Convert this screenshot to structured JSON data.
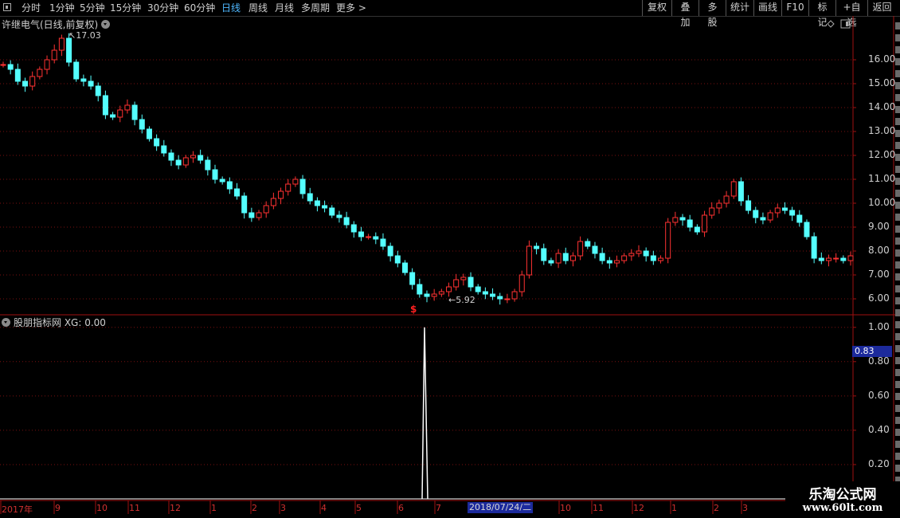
{
  "toolbar": {
    "periods": [
      "分时",
      "1分钟",
      "5分钟",
      "15分钟",
      "30分钟",
      "60分钟",
      "日线",
      "周线",
      "月线",
      "多周期",
      "更多 >"
    ],
    "active_period": "日线",
    "right_buttons": [
      "复权",
      "叠加",
      "多股",
      "统计",
      "画线",
      "F10",
      "标记",
      "+自选",
      "返回"
    ]
  },
  "main_chart": {
    "title": "许继电气(日线,前复权)",
    "high_marker": "17.03",
    "low_marker": "5.92",
    "signal_marker": "$",
    "price_axis": [
      "16.00",
      "15.00",
      "14.00",
      "13.00",
      "12.00",
      "11.00",
      "10.00",
      "9.00",
      "8.00",
      "7.00",
      "6.00"
    ]
  },
  "indicator": {
    "title": "股朋指标网 XG: 0.00",
    "axis": [
      "1.00",
      "0.80",
      "0.60",
      "0.40",
      "0.20"
    ],
    "cursor_value": "0.83"
  },
  "date_axis": {
    "ticks": [
      "2017年",
      "9",
      "10",
      "11",
      "12",
      "1",
      "2",
      "3",
      "4",
      "5",
      "6",
      "7",
      "10",
      "11",
      "12",
      "1",
      "2",
      "3"
    ],
    "cursor_date": "2018/07/24/二"
  },
  "watermark": {
    "line1": "乐淘公式网",
    "line2": "www.60lt.com"
  },
  "chart_data": {
    "type": "candlestick",
    "series": [
      {
        "values": [
          15.8,
          15.6,
          15.1,
          14.9,
          15.3,
          15.6,
          16.0,
          16.4,
          16.9,
          15.9,
          15.2,
          15.1,
          14.9,
          14.5,
          13.7,
          13.6,
          13.9,
          14.1,
          13.5,
          13.1,
          12.7,
          12.4,
          12.1,
          11.8,
          11.6,
          11.9,
          12.0,
          11.8,
          11.4,
          11.0,
          10.9,
          10.6,
          10.3,
          9.6,
          9.4,
          9.6,
          9.9,
          10.2,
          10.5,
          10.8,
          11.0,
          10.4,
          10.1,
          9.9,
          9.8,
          9.5,
          9.4,
          9.1,
          8.8,
          8.6,
          8.6,
          8.5,
          8.2,
          7.8,
          7.5,
          7.1,
          6.6,
          6.2,
          6.1,
          6.2,
          6.3,
          6.5,
          6.8,
          6.9,
          6.5,
          6.3,
          6.2,
          6.1,
          6.0,
          6.0,
          6.3,
          7.0,
          8.2,
          8.1,
          7.6,
          7.5,
          7.9,
          7.6,
          7.8,
          8.4,
          8.2,
          7.9,
          7.6,
          7.5,
          7.6,
          7.8,
          7.9,
          8.0,
          7.8,
          7.6,
          7.7,
          9.2,
          9.4,
          9.3,
          9.0,
          8.8,
          9.5,
          9.8,
          10.0,
          10.3,
          10.9,
          10.1,
          9.7,
          9.4,
          9.3,
          9.6,
          9.8,
          9.7,
          9.5,
          9.2,
          8.6,
          7.7,
          7.6,
          7.7,
          7.7,
          7.6,
          7.8
        ]
      }
    ],
    "y_ticks": [
      "16.00",
      "15.00",
      "14.00",
      "13.00",
      "12.00",
      "11.00",
      "10.00",
      "9.00",
      "8.00",
      "7.00",
      "6.00"
    ],
    "ylim": [
      5.5,
      17.3
    ],
    "indicator_series": {
      "name": "XG",
      "values": [
        0.0,
        1.0,
        0.0
      ]
    },
    "indicator_ylim": [
      0,
      1.05
    ]
  }
}
